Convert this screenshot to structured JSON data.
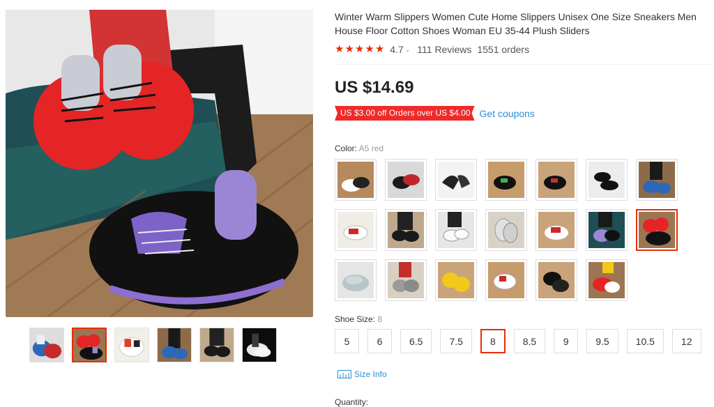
{
  "product": {
    "title": "Winter Warm Slippers Women Cute Home Slippers Unisex One Size Sneakers Men House Floor Cotton Shoes Woman EU 35-44 Plush Sliders",
    "rating": "4.7",
    "rating_stars": 5,
    "reviews": "111 Reviews",
    "orders": "1551 orders",
    "price": "US $14.69",
    "coupon_tag": "US $3.00 off Orders over US $4.00",
    "get_coupons": "Get coupons"
  },
  "color": {
    "label": "Color:",
    "selected": "A5 red",
    "swatch_count": 20,
    "selected_index": 13
  },
  "shoe_size": {
    "label": "Shoe Size:",
    "selected": "8",
    "options": [
      "5",
      "6",
      "6.5",
      "7.5",
      "8",
      "8.5",
      "9",
      "9.5",
      "10.5",
      "12"
    ],
    "size_info": "Size Info"
  },
  "quantity": {
    "label": "Quantity:"
  },
  "gallery": {
    "thumb_count": 6,
    "active_index": 1
  },
  "colors": {
    "accent": "#e62e04",
    "coupon": "#ef2a2a",
    "link": "#2f8fd1",
    "star": "#e62e04"
  }
}
